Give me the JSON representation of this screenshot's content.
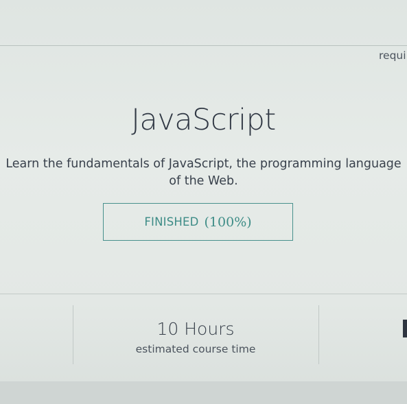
{
  "course": {
    "title": "JavaScript",
    "description": "Learn the fundamentals of JavaScript, the programming language of the Web.",
    "status": {
      "label": "FINISHED",
      "percent_text": "(100%)",
      "progress": 1.0
    }
  },
  "stats": [
    {
      "value": "10 Hours",
      "label": "estimated course time"
    },
    {
      "label_partial": "requi"
    }
  ],
  "colors": {
    "background": "#e3e8e5",
    "title_text": "#303844",
    "status_accent": "#47908c"
  }
}
